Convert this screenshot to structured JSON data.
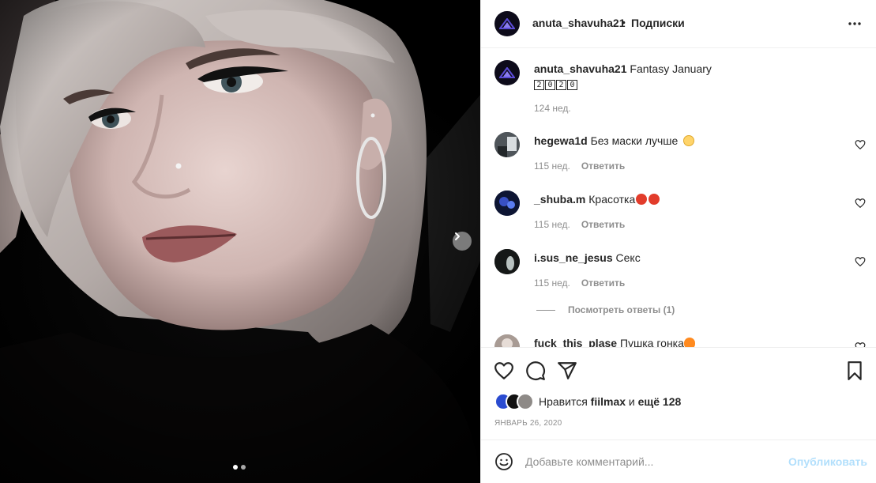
{
  "post": {
    "author": "anuta_shavuha21",
    "separator": "•",
    "follow_status": "Подписки",
    "caption_user": "anuta_shavuha21",
    "caption_text": "Fantasy January",
    "caption_year_boxes": [
      "2",
      "0",
      "2",
      "0"
    ],
    "caption_age": "124 нед.",
    "carousel": {
      "total_slides": 2,
      "active_slide": 1
    }
  },
  "comments": [
    {
      "user": "hegewa1d",
      "text": "Без маски лучше",
      "emoji": "blush-mask-emoji",
      "age": "115 нед.",
      "reply_label": "Ответить"
    },
    {
      "user": "_shuba.m",
      "text": "Красотка",
      "emoji": "devil-emoji-x2",
      "age": "115 нед.",
      "reply_label": "Ответить"
    },
    {
      "user": "i.sus_ne_jesus",
      "text": "Секс",
      "age": "115 нед.",
      "reply_label": "Ответить"
    },
    {
      "user": "fuck_this_plase",
      "text": "Пушка гонка",
      "emoji": "fire-emoji"
    }
  ],
  "view_replies": "Посмотреть ответы (1)",
  "likes": {
    "prefix": "Нравится",
    "user": "fiilmax",
    "conjunction": "и",
    "more": "ещё 128"
  },
  "date": "ЯНВАРЬ 26, 2020",
  "add_comment": {
    "placeholder": "Добавьте комментарий...",
    "publish_label": "Опубликовать"
  },
  "colors": {
    "accent_disabled": "#b2dffc",
    "secondary_text": "#8e8e8e",
    "primary_text": "#262626",
    "avatar_bg": "#0d0b1a",
    "avatar_logo": "#5b4bd6"
  }
}
